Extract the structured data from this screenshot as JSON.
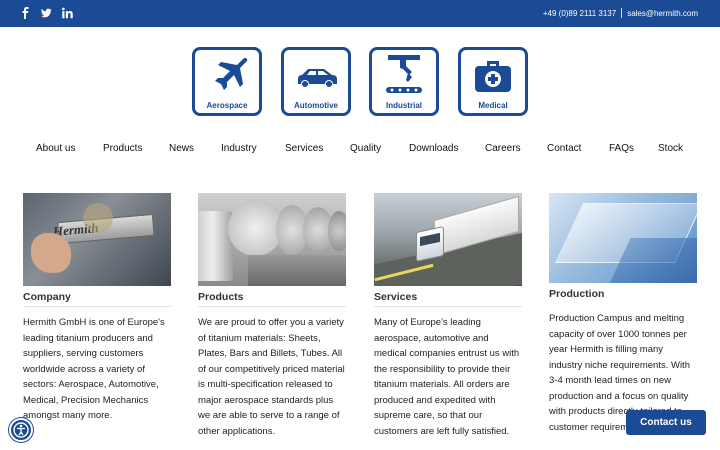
{
  "topbar": {
    "phone": "+49 (0)89 2111 3137",
    "email": "sales@hermith.com",
    "social": [
      "facebook-icon",
      "twitter-icon",
      "linkedin-icon"
    ]
  },
  "industries": [
    {
      "label": "Aerospace",
      "icon": "airplane-icon"
    },
    {
      "label": "Automotive",
      "icon": "car-icon"
    },
    {
      "label": "Industrial",
      "icon": "robot-arm-icon"
    },
    {
      "label": "Medical",
      "icon": "medical-kit-icon"
    }
  ],
  "nav": [
    "About us",
    "Products",
    "News",
    "Industry",
    "Services",
    "Quality",
    "Downloads",
    "Careers",
    "Contact",
    "FAQs",
    "Stock"
  ],
  "cards": [
    {
      "title": "Company",
      "image_text": "Hermith",
      "text": "Hermith GmbH is one of Europe's leading titanium producers and suppliers, serving customers worldwide across a variety of sectors: Aerospace, Automotive, Medical, Precision Mechanics amongst many more."
    },
    {
      "title": "Products",
      "text": "We are proud to offer you a variety of titanium materials: Sheets, Plates, Bars and Billets, Tubes. All of our competitively priced material is multi-specification released to major aerospace standards plus we are able to serve to a range of other applications."
    },
    {
      "title": "Services",
      "text": "Many of Europe's leading aerospace, automotive and medical companies entrust us with the responsibility to provide their titanium materials. All orders are produced and expedited with supreme care, so that our customers are left fully satisfied."
    },
    {
      "title": "Production",
      "text": "Production Campus and melting capacity of over 1000 tonnes per year Hermith is filling many industry niche requirements. With 3-4 month lead times on new production and  a focus on quality with products directly tailored to customer requirements, Hermith's"
    }
  ],
  "chat_button": "Contact us",
  "colors": {
    "brand": "#1a4b94",
    "text": "#222222"
  }
}
